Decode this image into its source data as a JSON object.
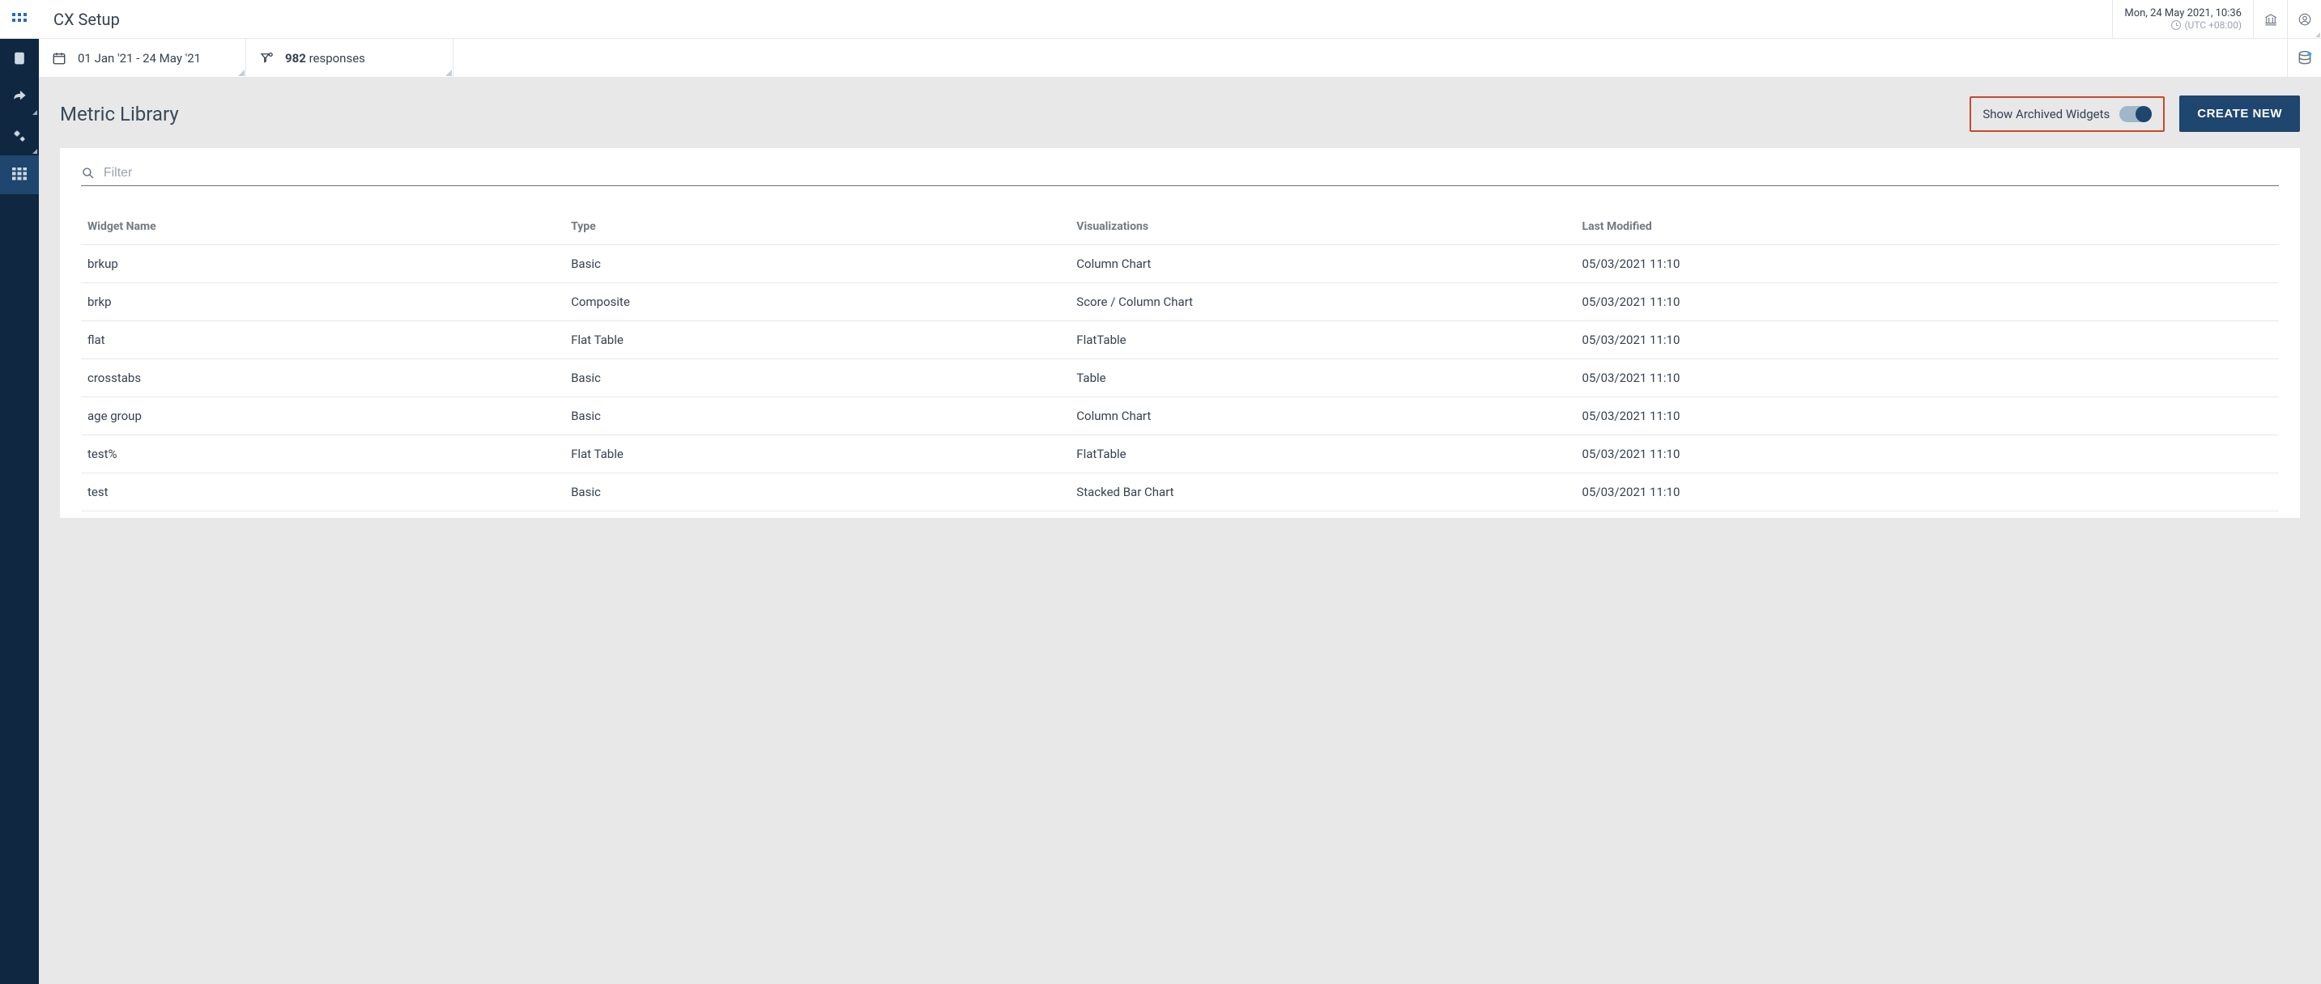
{
  "header": {
    "title": "CX Setup",
    "datetime": "Mon, 24 May 2021, 10:36",
    "timezone": "(UTC +08:00)"
  },
  "filters": {
    "date_range": "01 Jan '21 - 24 May '21",
    "responses_count": "982",
    "responses_label": "responses"
  },
  "section": {
    "title": "Metric Library",
    "archived_label": "Show Archived Widgets",
    "create_label": "CREATE NEW",
    "filter_placeholder": "Filter"
  },
  "table": {
    "headers": {
      "name": "Widget Name",
      "type": "Type",
      "viz": "Visualizations",
      "modified": "Last Modified"
    },
    "rows": [
      {
        "name": "brkup",
        "type": "Basic",
        "viz": "Column Chart",
        "modified": "05/03/2021 11:10"
      },
      {
        "name": "brkp",
        "type": "Composite",
        "viz": "Score / Column Chart",
        "modified": "05/03/2021 11:10"
      },
      {
        "name": "flat",
        "type": "Flat Table",
        "viz": "FlatTable",
        "modified": "05/03/2021 11:10"
      },
      {
        "name": "crosstabs",
        "type": "Basic",
        "viz": "Table",
        "modified": "05/03/2021 11:10"
      },
      {
        "name": "age group",
        "type": "Basic",
        "viz": "Column Chart",
        "modified": "05/03/2021 11:10"
      },
      {
        "name": "test%",
        "type": "Flat Table",
        "viz": "FlatTable",
        "modified": "05/03/2021 11:10"
      },
      {
        "name": "test",
        "type": "Basic",
        "viz": "Stacked Bar Chart",
        "modified": "05/03/2021 11:10"
      }
    ]
  }
}
